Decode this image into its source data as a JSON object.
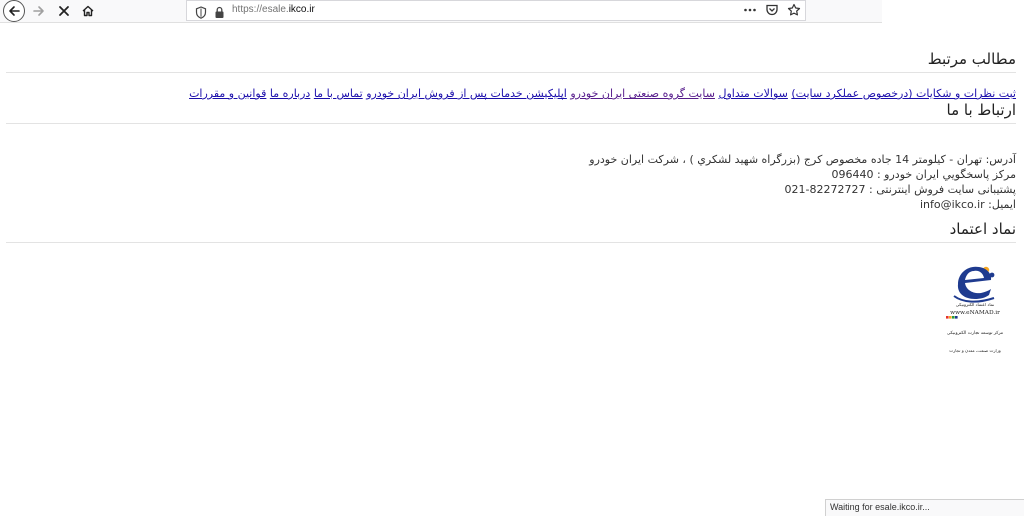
{
  "browser": {
    "url_prefix": "https://esale.",
    "url_domain": "ikco.ir",
    "status": "Waiting for esale.ikco.ir...",
    "icons": {
      "back": "arrow-left-icon",
      "forward": "arrow-right-icon",
      "stop": "close-icon",
      "home": "home-icon",
      "shield": "shield-icon",
      "lock": "lock-icon",
      "more": "more-horizontal-icon",
      "pocket": "pocket-icon",
      "bookmark": "star-icon"
    }
  },
  "related": {
    "title": "مطالب مرتبط",
    "links": [
      {
        "label": "ثبت نظرات و شکایات (درخصوص عملکرد سایت)",
        "visited": false
      },
      {
        "label": "سوالات متداول",
        "visited": false
      },
      {
        "label": "سایت گروه صنعتی ایران خودرو",
        "visited": true
      },
      {
        "label": "اپلیکیشن خدمات پس از فروش ایران خودرو",
        "visited": false
      },
      {
        "label": "تماس با ما",
        "visited": false
      },
      {
        "label": "درباره ما",
        "visited": false
      },
      {
        "label": "قوانین و مقررات",
        "visited": false
      }
    ]
  },
  "contact": {
    "title": "ارتباط با ما",
    "address": "آدرس: تهران - کیلومتر 14 جاده مخصوص کرج (بزرگراه شهید لشكري ) ، شرکت ایران خودرو",
    "call_center": "مرکز پاسخگويي ايران خودرو : 096440",
    "support": "پشتیبانی سایت فروش اینترنتی : 82272727-021",
    "email": "ایمیل: info@ikco.ir"
  },
  "trust": {
    "title": "نماد اعتماد",
    "badge_lines": [
      "نماد اعتماد الکترونیکی",
      "www.eNAMAD.ir",
      "مرکز توسعه تجارت الکترونیکی",
      "وزارت صنعت، معدن و تجارت"
    ]
  }
}
